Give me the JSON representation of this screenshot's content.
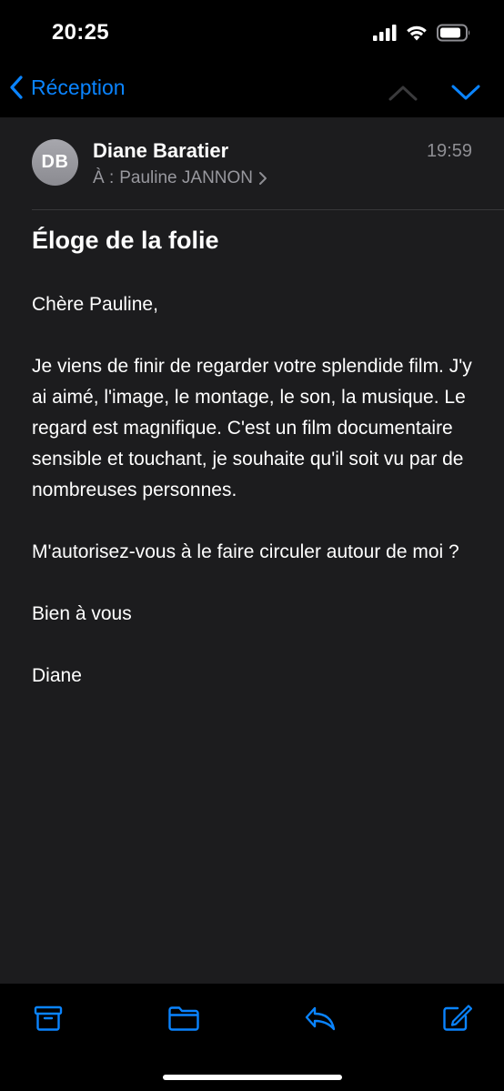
{
  "status_bar": {
    "time": "20:25"
  },
  "nav": {
    "back_label": "Réception",
    "accent_color": "#0a84ff"
  },
  "message": {
    "avatar_initials": "DB",
    "sender": "Diane Baratier",
    "time": "19:59",
    "recipient_prefix": "À :",
    "recipient": "Pauline JANNON",
    "subject": "Éloge de la folie",
    "body": [
      "Chère Pauline,",
      "Je viens de finir de regarder votre splendide film. J'y ai aimé, l'image, le montage, le son, la musique. Le regard est magnifique. C'est un film documentaire sensible et touchant, je souhaite qu'il soit vu par de nombreuses personnes.",
      "M'autorisez-vous à le faire circuler autour de moi ?",
      "Bien à vous",
      "Diane"
    ]
  },
  "toolbar": {
    "icons": [
      "archive-icon",
      "folder-icon",
      "reply-icon",
      "compose-icon"
    ]
  }
}
